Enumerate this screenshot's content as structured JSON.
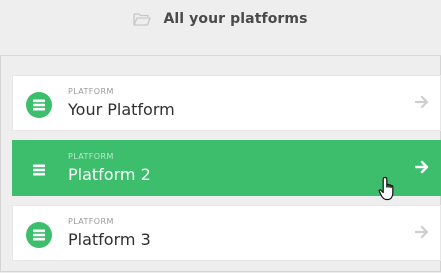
{
  "header": {
    "title": "All your platforms",
    "icon": "folder-open-icon"
  },
  "platforms": [
    {
      "kicker": "PLATFORM",
      "name": "Your Platform",
      "active": false
    },
    {
      "kicker": "PLATFORM",
      "name": "Platform 2",
      "active": true
    },
    {
      "kicker": "PLATFORM",
      "name": "Platform 3",
      "active": false
    }
  ],
  "colors": {
    "accent": "#3cbe6c",
    "header_bg": "#eeeeee",
    "text_dark": "#2f2f2f",
    "muted": "#9a9a9a"
  },
  "cursor": "hand-pointer-icon"
}
